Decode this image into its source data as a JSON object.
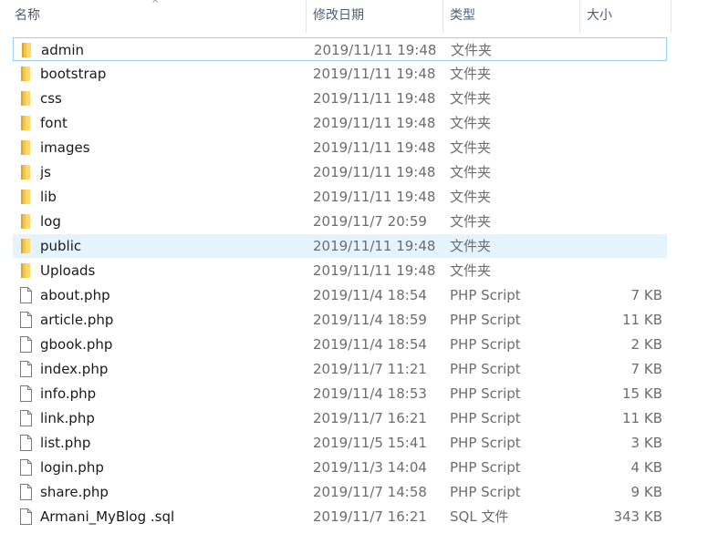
{
  "columns": {
    "name": "名称",
    "date": "修改日期",
    "type": "类型",
    "size": "大小"
  },
  "sort": {
    "column": "name",
    "direction": "ascending",
    "indicator": "^"
  },
  "files": [
    {
      "name": "admin",
      "date": "2019/11/11 19:48",
      "type": "文件夹",
      "size": "",
      "kind": "folder",
      "icon": "folder-icon",
      "state": "focused"
    },
    {
      "name": "bootstrap",
      "date": "2019/11/11 19:48",
      "type": "文件夹",
      "size": "",
      "kind": "folder",
      "icon": "folder-icon"
    },
    {
      "name": "css",
      "date": "2019/11/11 19:48",
      "type": "文件夹",
      "size": "",
      "kind": "folder",
      "icon": "folder-icon"
    },
    {
      "name": "font",
      "date": "2019/11/11 19:48",
      "type": "文件夹",
      "size": "",
      "kind": "folder",
      "icon": "folder-icon"
    },
    {
      "name": "images",
      "date": "2019/11/11 19:48",
      "type": "文件夹",
      "size": "",
      "kind": "folder",
      "icon": "folder-icon"
    },
    {
      "name": "js",
      "date": "2019/11/11 19:48",
      "type": "文件夹",
      "size": "",
      "kind": "folder",
      "icon": "folder-icon"
    },
    {
      "name": "lib",
      "date": "2019/11/11 19:48",
      "type": "文件夹",
      "size": "",
      "kind": "folder",
      "icon": "folder-icon"
    },
    {
      "name": "log",
      "date": "2019/11/7 20:59",
      "type": "文件夹",
      "size": "",
      "kind": "folder",
      "icon": "folder-icon"
    },
    {
      "name": "public",
      "date": "2019/11/11 19:48",
      "type": "文件夹",
      "size": "",
      "kind": "folder",
      "icon": "folder-icon",
      "state": "hovered"
    },
    {
      "name": "Uploads",
      "date": "2019/11/11 19:48",
      "type": "文件夹",
      "size": "",
      "kind": "folder",
      "icon": "folder-icon"
    },
    {
      "name": "about.php",
      "date": "2019/11/4 18:54",
      "type": "PHP Script",
      "size": "7 KB",
      "kind": "file",
      "icon": "file-icon"
    },
    {
      "name": "article.php",
      "date": "2019/11/4 18:59",
      "type": "PHP Script",
      "size": "11 KB",
      "kind": "file",
      "icon": "file-icon"
    },
    {
      "name": "gbook.php",
      "date": "2019/11/4 18:54",
      "type": "PHP Script",
      "size": "2 KB",
      "kind": "file",
      "icon": "file-icon"
    },
    {
      "name": "index.php",
      "date": "2019/11/7 11:21",
      "type": "PHP Script",
      "size": "7 KB",
      "kind": "file",
      "icon": "file-icon"
    },
    {
      "name": "info.php",
      "date": "2019/11/4 18:53",
      "type": "PHP Script",
      "size": "15 KB",
      "kind": "file",
      "icon": "file-icon"
    },
    {
      "name": "link.php",
      "date": "2019/11/7 16:21",
      "type": "PHP Script",
      "size": "11 KB",
      "kind": "file",
      "icon": "file-icon"
    },
    {
      "name": "list.php",
      "date": "2019/11/5 15:41",
      "type": "PHP Script",
      "size": "3 KB",
      "kind": "file",
      "icon": "file-icon"
    },
    {
      "name": "login.php",
      "date": "2019/11/3 14:04",
      "type": "PHP Script",
      "size": "4 KB",
      "kind": "file",
      "icon": "file-icon"
    },
    {
      "name": "share.php",
      "date": "2019/11/7 14:58",
      "type": "PHP Script",
      "size": "9 KB",
      "kind": "file",
      "icon": "file-icon"
    },
    {
      "name": "Armani_MyBlog .sql",
      "date": "2019/11/7 16:21",
      "type": "SQL 文件",
      "size": "343 KB",
      "kind": "file",
      "icon": "file-icon"
    }
  ],
  "colors": {
    "header_text": "#4c607a",
    "hover_bg": "#e5f3ff",
    "focus_border": "#99d1ff",
    "folder_yellow": "#f5c85a"
  }
}
